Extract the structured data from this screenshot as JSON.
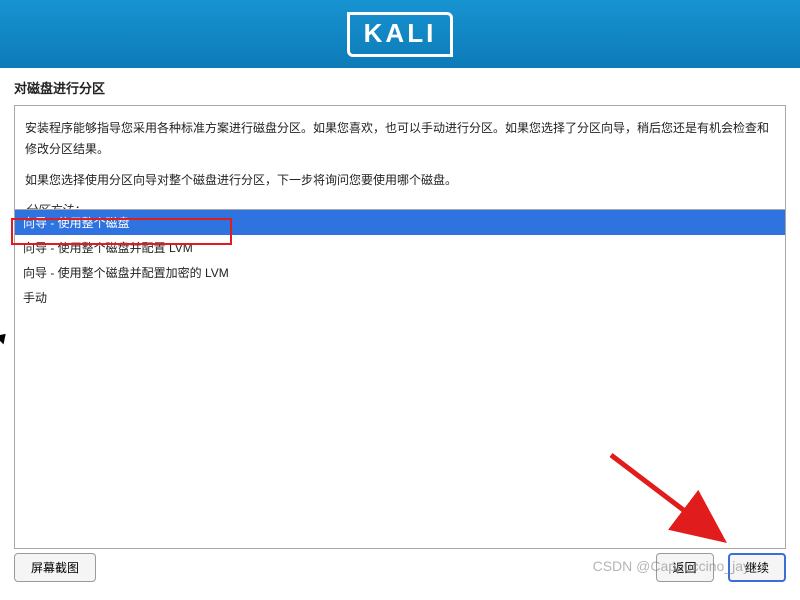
{
  "header": {
    "logo_text": "KALI"
  },
  "title": "对磁盘进行分区",
  "main": {
    "paragraph1": "安装程序能够指导您采用各种标准方案进行磁盘分区。如果您喜欢，也可以手动进行分区。如果您选择了分区向导，稍后您还是有机会检查和修改分区结果。",
    "paragraph2": "如果您选择使用分区向导对整个磁盘进行分区，下一步将询问您要使用哪个磁盘。",
    "subtitle": "分区方法：",
    "options": [
      "向导 - 使用整个磁盘",
      "向导 - 使用整个磁盘并配置 LVM",
      "向导 - 使用整个磁盘并配置加密的 LVM",
      "手动"
    ],
    "selected_index": 0
  },
  "footer": {
    "screenshot_label": "屏幕截图",
    "back_label": "返回",
    "continue_label": "继续"
  },
  "watermark": "CSDN @Cappuccino_jay"
}
